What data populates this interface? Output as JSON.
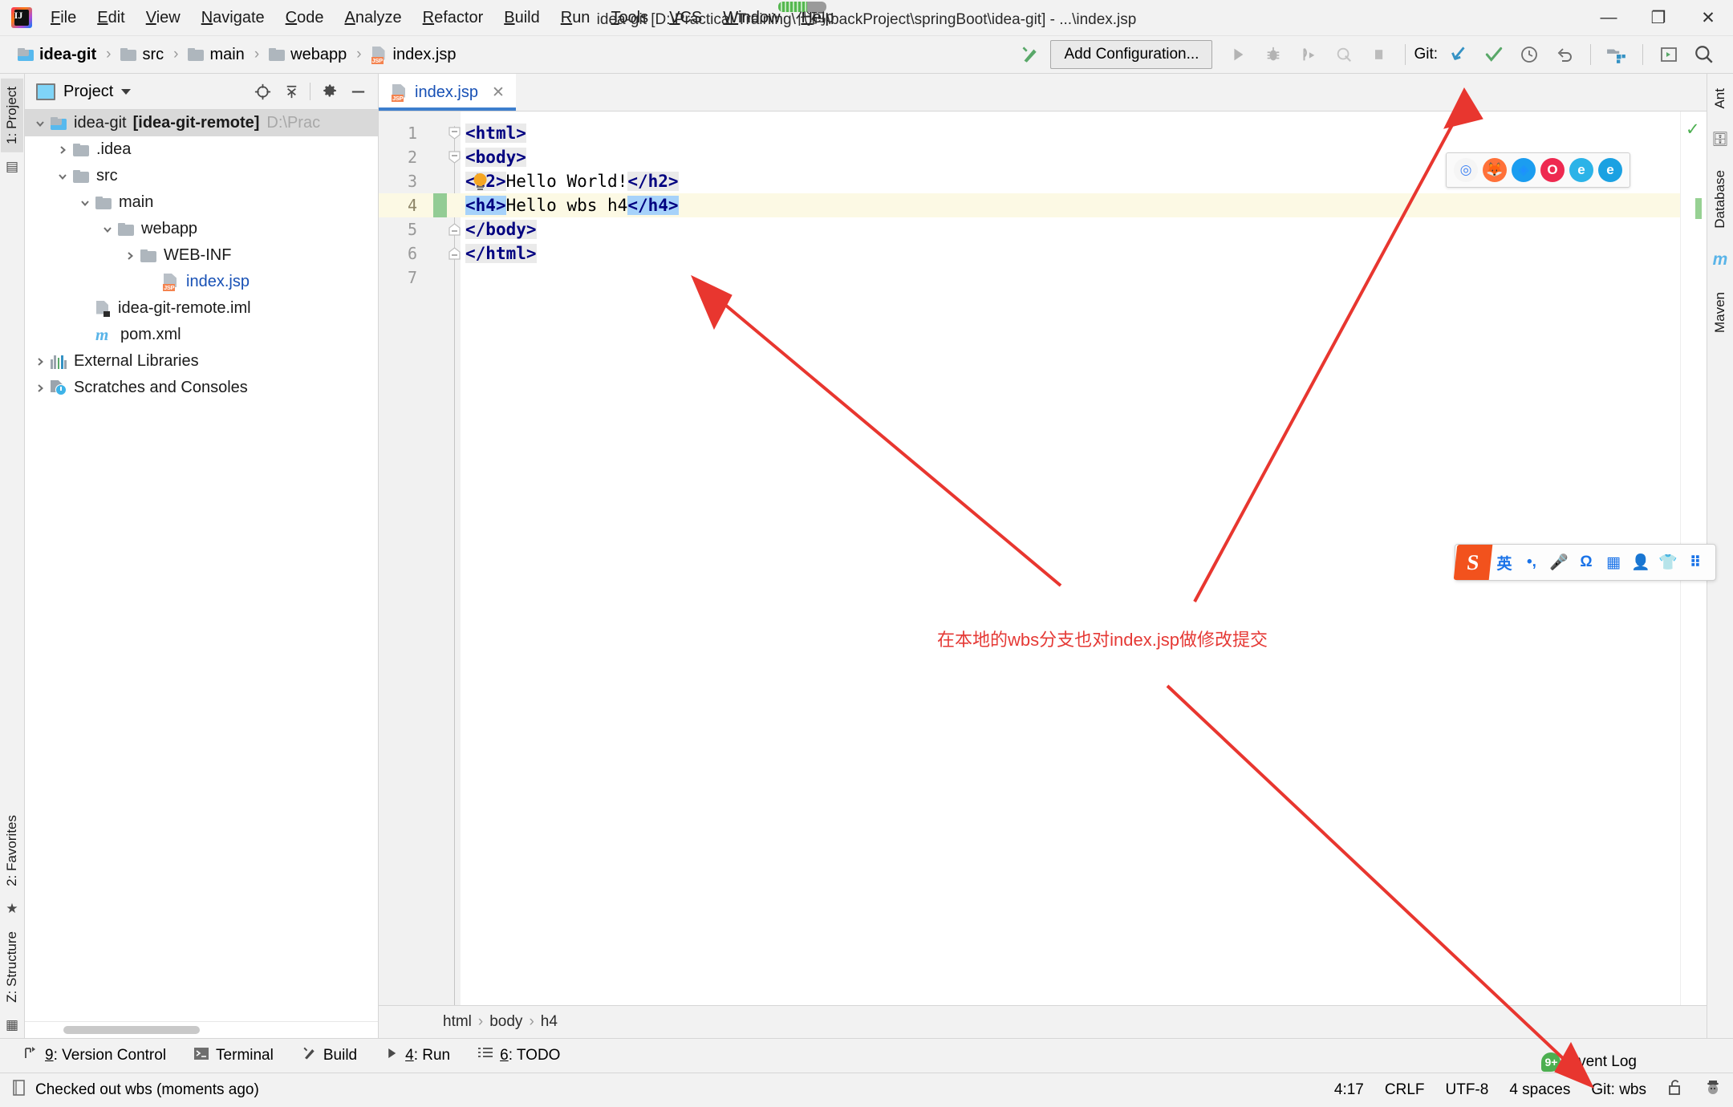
{
  "window": {
    "title": "idea-git [D:\\Practical Training\\代码\\backProject\\springBoot\\idea-git] - ...\\index.jsp",
    "minimize": "—",
    "maximize": "❐",
    "close": "✕"
  },
  "menubar": {
    "items": [
      {
        "label": "File",
        "pre": "F",
        "mid": "ile"
      },
      {
        "label": "Edit",
        "pre": "E",
        "mid": "dit"
      },
      {
        "label": "View",
        "pre": "V",
        "mid": "iew"
      },
      {
        "label": "Navigate",
        "pre": "N",
        "mid": "avigate"
      },
      {
        "label": "Code",
        "pre": "C",
        "mid": "ode"
      },
      {
        "label": "Analyze",
        "pre": "A",
        "mid": "nalyze"
      },
      {
        "label": "Refactor",
        "pre": "R",
        "mid": "efactor"
      },
      {
        "label": "Build",
        "pre": "B",
        "mid": "uild"
      },
      {
        "label": "Run",
        "pre": "R",
        "mid": "un"
      },
      {
        "label": "Tools",
        "pre": "T",
        "mid": "ools"
      },
      {
        "label": "VCS",
        "pre": "V",
        "mid": "CS"
      },
      {
        "label": "Window",
        "pre": "W",
        "mid": "indow"
      },
      {
        "label": "Help",
        "pre": "H",
        "mid": "elp"
      }
    ]
  },
  "toolbar": {
    "breadcrumbs": [
      {
        "label": "idea-git",
        "icon": "folder-module-icon"
      },
      {
        "label": "src",
        "icon": "folder-icon"
      },
      {
        "label": "main",
        "icon": "folder-icon"
      },
      {
        "label": "webapp",
        "icon": "folder-icon"
      },
      {
        "label": "index.jsp",
        "icon": "jsp-file-icon"
      }
    ],
    "separator": "›",
    "build_icon": "build-hammer-icon",
    "add_configuration": "Add Configuration...",
    "run_icon": "run-icon",
    "debug_icon": "debug-icon",
    "run_coverage_icon": "run-with-coverage-icon",
    "profile_icon": "profile-icon",
    "stop_icon": "stop-icon",
    "git_label": "Git:",
    "git_update_icon": "update-project-icon",
    "git_commit_icon": "commit-icon",
    "git_history_icon": "history-icon",
    "git_rollback_icon": "rollback-icon",
    "project_structure_icon": "project-structure-icon",
    "terminal_icon": "terminal-icon",
    "search_icon": "search-everywhere-icon"
  },
  "left_rail": {
    "top": [
      "1: Project"
    ],
    "bottom": [
      "2: Favorites",
      "Z: Structure"
    ]
  },
  "right_rail": {
    "items": [
      "Ant",
      "Database",
      "Maven"
    ]
  },
  "project_panel": {
    "title": "Project",
    "tools": {
      "locate_icon": "locate-target-icon",
      "collapse_icon": "collapse-all-icon",
      "settings_icon": "gear-icon",
      "hide_icon": "hide-panel-icon"
    },
    "tree": [
      {
        "label": "idea-git",
        "bold_suffix": "[idea-git-remote]",
        "dim": "D:\\Prac",
        "indent": 0,
        "twist": "v",
        "icon": "folder-module-icon",
        "selected": true
      },
      {
        "label": ".idea",
        "indent": 1,
        "twist": ">",
        "icon": "folder-icon"
      },
      {
        "label": "src",
        "indent": 1,
        "twist": "v",
        "icon": "folder-icon"
      },
      {
        "label": "main",
        "indent": 2,
        "twist": "v",
        "icon": "folder-icon"
      },
      {
        "label": "webapp",
        "indent": 3,
        "twist": "v",
        "icon": "folder-icon"
      },
      {
        "label": "WEB-INF",
        "indent": 4,
        "twist": ">",
        "icon": "folder-icon"
      },
      {
        "label": "index.jsp",
        "indent": 5,
        "twist": "",
        "icon": "jsp-file-icon",
        "blue": true
      },
      {
        "label": "idea-git-remote.iml",
        "indent": 2,
        "twist": "",
        "icon": "iml-file-icon"
      },
      {
        "label": "pom.xml",
        "indent": 2,
        "twist": "",
        "icon": "maven-file-icon"
      },
      {
        "label": "External Libraries",
        "indent": 0,
        "twist": ">",
        "icon": "libraries-icon"
      },
      {
        "label": "Scratches and Consoles",
        "indent": 0,
        "twist": ">",
        "icon": "scratches-icon"
      }
    ]
  },
  "editor": {
    "tab": {
      "name": "index.jsp",
      "icon": "jsp-file-icon",
      "close": "✕"
    },
    "lines": [
      {
        "n": "1",
        "fold": "minus",
        "current": false,
        "parts": [
          {
            "t": "<",
            "c": "brk",
            "hl": "grey"
          },
          {
            "t": "html",
            "c": "tag",
            "hl": "grey"
          },
          {
            "t": ">",
            "c": "brk",
            "hl": "grey"
          }
        ]
      },
      {
        "n": "2",
        "fold": "minus",
        "current": false,
        "parts": [
          {
            "t": "<",
            "c": "brk",
            "hl": "grey"
          },
          {
            "t": "body",
            "c": "tag",
            "hl": "grey"
          },
          {
            "t": ">",
            "c": "brk",
            "hl": "grey"
          }
        ]
      },
      {
        "n": "3",
        "fold": "",
        "current": false,
        "bulb": true,
        "parts": [
          {
            "t": "<",
            "c": "brk",
            "hl": "grey"
          },
          {
            "t": "h2",
            "c": "tag",
            "hl": "grey"
          },
          {
            "t": ">",
            "c": "brk",
            "hl": "grey"
          },
          {
            "t": "Hello World!",
            "c": "txt",
            "hl": ""
          },
          {
            "t": "<",
            "c": "brk",
            "hl": "grey"
          },
          {
            "t": "/h2",
            "c": "tag",
            "hl": "grey"
          },
          {
            "t": ">",
            "c": "brk",
            "hl": "grey"
          }
        ]
      },
      {
        "n": "4",
        "fold": "",
        "current": true,
        "changed": true,
        "parts": [
          {
            "t": "<",
            "c": "brk",
            "hl": "blue"
          },
          {
            "t": "h4",
            "c": "tag",
            "hl": "blue"
          },
          {
            "t": ">",
            "c": "brk",
            "hl": "blue"
          },
          {
            "t": "Hello wbs h4",
            "c": "txt",
            "hl": ""
          },
          {
            "t": "<",
            "c": "brk",
            "hl": "blue"
          },
          {
            "t": "/h4",
            "c": "tag",
            "hl": "blue"
          },
          {
            "t": ">",
            "c": "brk",
            "hl": "blue"
          }
        ]
      },
      {
        "n": "5",
        "fold": "minusdn",
        "current": false,
        "parts": [
          {
            "t": "<",
            "c": "brk",
            "hl": "grey"
          },
          {
            "t": "/body",
            "c": "tag",
            "hl": "grey"
          },
          {
            "t": ">",
            "c": "brk",
            "hl": "grey"
          }
        ]
      },
      {
        "n": "6",
        "fold": "minusdn",
        "current": false,
        "parts": [
          {
            "t": "<",
            "c": "brk",
            "hl": "grey"
          },
          {
            "t": "/html",
            "c": "tag",
            "hl": "grey"
          },
          {
            "t": ">",
            "c": "brk",
            "hl": "grey"
          }
        ]
      },
      {
        "n": "7",
        "fold": "",
        "current": false,
        "parts": []
      }
    ],
    "inspection_ok_icon": "inspection-ok-icon",
    "breadcrumb": [
      "html",
      "body",
      "h4"
    ],
    "breadcrumb_sep": "›"
  },
  "tool_windows": [
    {
      "label": "9: Version Control",
      "num": "9",
      "rest": ": Version Control",
      "icon": "version-control-icon"
    },
    {
      "label": "Terminal",
      "num": "",
      "rest": "Terminal",
      "icon": "terminal-icon"
    },
    {
      "label": "Build",
      "num": "",
      "rest": "Build",
      "icon": "build-hammer-icon"
    },
    {
      "label": "4: Run",
      "num": "4",
      "rest": ": Run",
      "icon": "run-icon"
    },
    {
      "label": "6: TODO",
      "num": "6",
      "rest": ": TODO",
      "icon": "todo-list-icon"
    }
  ],
  "status_bar": {
    "message": "Checked out wbs (moments ago)",
    "message_icon": "notification-icon",
    "event_log": "Event Log",
    "event_log_badge": "9+",
    "position": "4:17",
    "line_separator": "CRLF",
    "encoding": "UTF-8",
    "indent": "4 spaces",
    "git_branch": "Git: wbs",
    "lock_icon": "unlocked-icon",
    "inspector_icon": "hector-inspector-icon"
  },
  "overlays": {
    "browsers": [
      {
        "name": "chrome-icon",
        "glyph": "◎",
        "color": "#4285f4",
        "bg": "#f5f5f5"
      },
      {
        "name": "firefox-icon",
        "glyph": "🦊",
        "color": "#ff9500",
        "bg": "#ff7139"
      },
      {
        "name": "safari-icon",
        "glyph": "◈",
        "color": "#1e90ff",
        "bg": "#1b9df0"
      },
      {
        "name": "opera-icon",
        "glyph": "O",
        "color": "#fff",
        "bg": "#ee2950"
      },
      {
        "name": "edge-icon",
        "glyph": "e",
        "color": "#fff",
        "bg": "#2bb3e8"
      },
      {
        "name": "ie-icon",
        "glyph": "e",
        "color": "#fff",
        "bg": "#1ba1e2"
      }
    ],
    "sogou_ime": {
      "logo": "S",
      "buttons": [
        {
          "name": "language-mode-icon",
          "glyph": "英"
        },
        {
          "name": "punctuation-icon",
          "glyph": "•,"
        },
        {
          "name": "voice-input-icon",
          "glyph": "🎤"
        },
        {
          "name": "symbol-input-icon",
          "glyph": "Ω"
        },
        {
          "name": "soft-keyboard-icon",
          "glyph": "▦"
        },
        {
          "name": "user-profile-icon",
          "glyph": "👤"
        },
        {
          "name": "skin-icon",
          "glyph": "👕"
        },
        {
          "name": "toolbox-icon",
          "glyph": "⠿"
        }
      ]
    },
    "annotation": {
      "text": "在本地的wbs分支也对index.jsp做修改提交",
      "color": "#e53935"
    }
  }
}
